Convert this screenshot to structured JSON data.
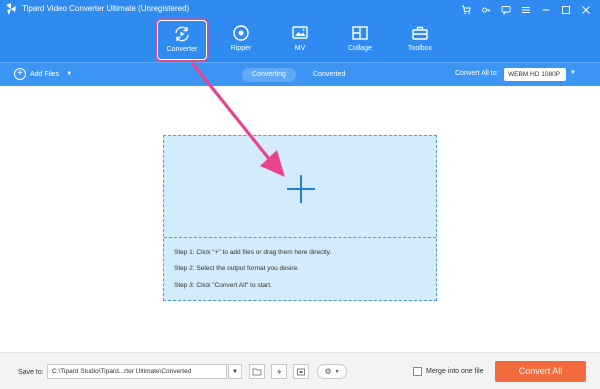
{
  "window": {
    "title": "Tipard Video Converter Ultimate (Unregistered)",
    "icons": [
      "cart-icon",
      "key-icon",
      "chat-icon",
      "menu-icon",
      "minimize-icon",
      "maximize-icon",
      "close-icon"
    ]
  },
  "nav": {
    "items": [
      {
        "label": "Converter",
        "icon": "converter-icon",
        "active": true
      },
      {
        "label": "Ripper",
        "icon": "ripper-icon"
      },
      {
        "label": "MV",
        "icon": "mv-icon"
      },
      {
        "label": "Collage",
        "icon": "collage-icon"
      },
      {
        "label": "Toolbox",
        "icon": "toolbox-icon"
      }
    ]
  },
  "toolbar": {
    "add_files": "Add Files",
    "tabs": [
      {
        "label": "Converting",
        "active": true
      },
      {
        "label": "Converted"
      }
    ],
    "convert_all_to": "Convert All to:",
    "format": "WEBM HD 1080P"
  },
  "dropzone": {
    "steps": [
      "Step 1: Click \"+\" to add files or drag them here directly.",
      "Step 2: Select the output format you desire.",
      "Step 3: Click \"Convert All\" to start."
    ]
  },
  "bottom": {
    "save_to_label": "Save to:",
    "save_path": "C:\\Tipard Studio\\Tipard...rter Ultimate\\Converted",
    "merge_label": "Merge into one file",
    "convert_all": "Convert All"
  },
  "colors": {
    "header_blue": "#2f8bf0",
    "accent_orange": "#f26a3d",
    "annotation_pink": "#e8458b",
    "dropzone_bg": "#d3ebfa"
  }
}
